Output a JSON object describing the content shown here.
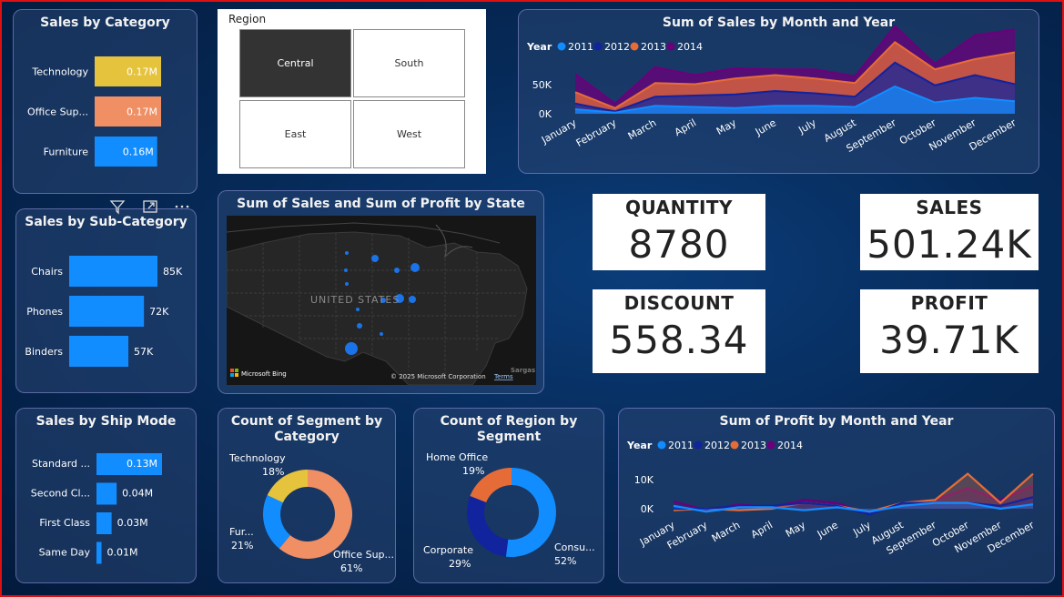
{
  "colors": {
    "bar": "#118dff",
    "tech": "#e6c33c",
    "office": "#ef8f63",
    "y2011": "#118dff",
    "y2012": "#12239e",
    "y2013": "#e66c37",
    "y2014": "#6b007b"
  },
  "sales_by_category": {
    "title": "Sales by Category",
    "chart_data": {
      "type": "bar",
      "title": "Sales by Category",
      "categories": [
        "Technology",
        "Office Sup...",
        "Furniture"
      ],
      "values": [
        0.17,
        0.17,
        0.16
      ],
      "value_labels": [
        "0.17M",
        "0.17M",
        "0.16M"
      ],
      "bar_colors": [
        "#e6c33c",
        "#ef8f63",
        "#118dff"
      ]
    }
  },
  "region_slicer": {
    "title": "Region",
    "options": [
      "Central",
      "South",
      "East",
      "West"
    ],
    "selected": "Central"
  },
  "sales_month_year": {
    "title": "Sum of Sales by Month and Year",
    "legend_title": "Year",
    "chart_data": {
      "type": "area",
      "title": "Sum of Sales by Month and Year",
      "x": [
        "January",
        "February",
        "March",
        "April",
        "May",
        "June",
        "July",
        "August",
        "September",
        "October",
        "November",
        "December"
      ],
      "y_ticks": [
        "50K",
        "0K"
      ],
      "series": [
        {
          "name": "2011",
          "values": [
            4,
            1,
            7,
            6,
            5,
            7,
            7,
            6,
            24,
            10,
            14,
            11
          ]
        },
        {
          "name": "2012",
          "values": [
            5,
            1,
            8,
            10,
            12,
            13,
            11,
            9,
            21,
            15,
            20,
            15
          ]
        },
        {
          "name": "2013",
          "values": [
            10,
            3,
            12,
            10,
            14,
            14,
            13,
            12,
            18,
            14,
            14,
            28
          ]
        },
        {
          "name": "2014",
          "values": [
            16,
            4,
            14,
            8,
            9,
            5,
            8,
            6,
            14,
            5,
            21,
            20
          ]
        }
      ]
    }
  },
  "sales_by_subcategory": {
    "title": "Sales by Sub-Category",
    "chart_data": {
      "type": "bar",
      "title": "Sales by Sub-Category",
      "categories": [
        "Chairs",
        "Phones",
        "Binders"
      ],
      "values": [
        85,
        72,
        57
      ],
      "value_labels": [
        "85K",
        "72K",
        "57K"
      ]
    }
  },
  "map": {
    "title": "Sum of Sales and Sum of Profit by State",
    "country_label": "UNITED STATES",
    "brand": "Microsoft Bing",
    "copyright": "© 2025 Microsoft Corporation",
    "terms": "Terms",
    "corner": "Sargas"
  },
  "kpis": {
    "quantity": {
      "label": "QUANTITY",
      "value": "8780"
    },
    "sales": {
      "label": "SALES",
      "value": "501.24K"
    },
    "discount": {
      "label": "DISCOUNT",
      "value": "558.34"
    },
    "profit": {
      "label": "PROFIT",
      "value": "39.71K"
    }
  },
  "sales_by_ship_mode": {
    "title": "Sales by Ship Mode",
    "chart_data": {
      "type": "bar",
      "title": "Sales by Ship Mode",
      "categories": [
        "Standard ...",
        "Second Cl...",
        "First Class",
        "Same Day"
      ],
      "values": [
        0.13,
        0.04,
        0.03,
        0.01
      ],
      "value_labels": [
        "0.13M",
        "0.04M",
        "0.03M",
        "0.01M"
      ]
    }
  },
  "segment_by_category": {
    "title_line1": "Count of Segment by",
    "title_line2": "Category",
    "chart_data": {
      "type": "pie",
      "title": "Count of Segment by Category",
      "labels": [
        "Office Sup...",
        "Fur...",
        "Technology"
      ],
      "values": [
        61,
        21,
        18
      ],
      "pct_labels": [
        "61%",
        "21%",
        "18%"
      ],
      "colors": [
        "#ef8f63",
        "#118dff",
        "#e6c33c"
      ]
    }
  },
  "region_by_segment": {
    "title_line1": "Count of Region by",
    "title_line2": "Segment",
    "chart_data": {
      "type": "pie",
      "title": "Count of Region by Segment",
      "labels": [
        "Consu...",
        "Corporate",
        "Home Office"
      ],
      "values": [
        52,
        29,
        19
      ],
      "pct_labels": [
        "52%",
        "29%",
        "19%"
      ],
      "colors": [
        "#118dff",
        "#12239e",
        "#e66c37"
      ]
    }
  },
  "profit_month_year": {
    "title": "Sum of Profit by Month and Year",
    "legend_title": "Year",
    "chart_data": {
      "type": "line",
      "title": "Sum of Profit by Month and Year",
      "x": [
        "January",
        "February",
        "March",
        "April",
        "May",
        "June",
        "July",
        "August",
        "September",
        "October",
        "November",
        "December"
      ],
      "y_ticks": [
        "10K",
        "0K"
      ],
      "series": [
        {
          "name": "2011",
          "values": [
            1,
            -1,
            0.5,
            0.5,
            -0.5,
            0.5,
            -1,
            1,
            2,
            2,
            0,
            1.5
          ]
        },
        {
          "name": "2012",
          "values": [
            0,
            0,
            1,
            1,
            2,
            1,
            -2,
            2,
            2,
            2,
            1,
            4
          ]
        },
        {
          "name": "2013",
          "values": [
            -0.5,
            0,
            -0.5,
            0,
            2,
            1,
            -1,
            2,
            3,
            12,
            2,
            12
          ]
        },
        {
          "name": "2014",
          "values": [
            2.5,
            -0.5,
            1.5,
            0.5,
            3,
            2,
            -2,
            2,
            3,
            7,
            3,
            8
          ]
        }
      ]
    }
  }
}
